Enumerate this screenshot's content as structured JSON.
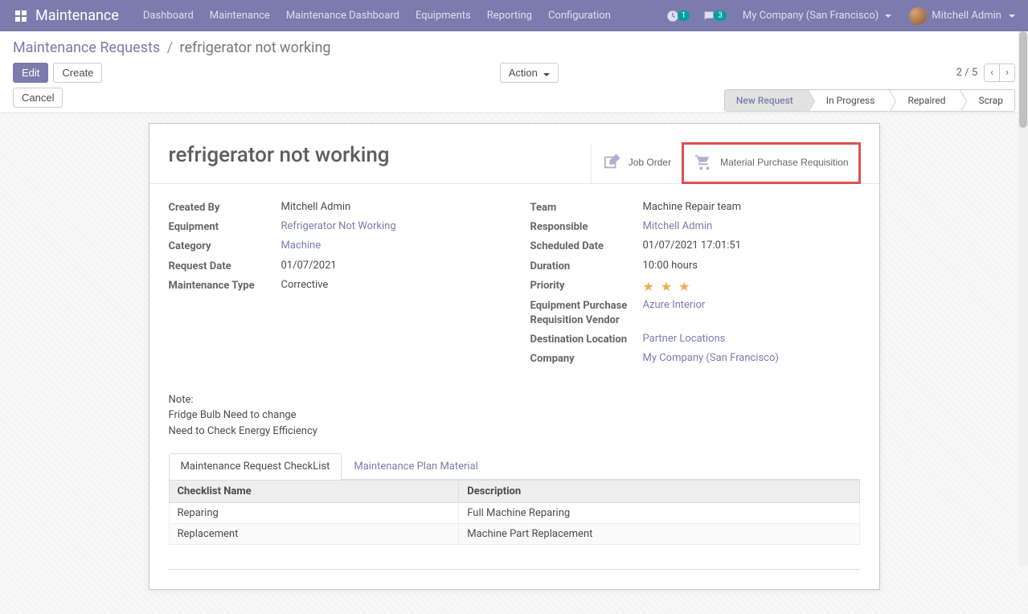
{
  "navbar": {
    "brand": "Maintenance",
    "items": [
      "Dashboard",
      "Maintenance",
      "Maintenance Dashboard",
      "Equipments",
      "Reporting",
      "Configuration"
    ],
    "activity_count": "1",
    "discuss_count": "3",
    "company": "My Company (San Francisco)",
    "user_name": "Mitchell Admin"
  },
  "breadcrumb": {
    "parent": "Maintenance Requests",
    "active": "refrigerator not working"
  },
  "buttons": {
    "edit": "Edit",
    "create": "Create",
    "action": "Action",
    "cancel": "Cancel"
  },
  "pager": {
    "text": "2 / 5"
  },
  "status_steps": [
    "New Request",
    "In Progress",
    "Repaired",
    "Scrap"
  ],
  "status_active_index": 0,
  "record": {
    "title": "refrigerator not working",
    "stat_buttons": {
      "job_order": "Job Order",
      "material_req": "Material Purchase Requisition"
    },
    "left_fields": {
      "created_by": {
        "label": "Created By",
        "value": "Mitchell Admin"
      },
      "equipment": {
        "label": "Equipment",
        "value": "Refrigerator Not Working",
        "link": true
      },
      "category": {
        "label": "Category",
        "value": "Machine",
        "link": true
      },
      "request_date": {
        "label": "Request Date",
        "value": "01/07/2021"
      },
      "maintenance_type": {
        "label": "Maintenance Type",
        "value": "Corrective"
      }
    },
    "right_fields": {
      "team": {
        "label": "Team",
        "value": "Machine Repair team"
      },
      "responsible": {
        "label": "Responsible",
        "value": "Mitchell Admin",
        "link": true
      },
      "scheduled_date": {
        "label": "Scheduled Date",
        "value": "01/07/2021 17:01:51"
      },
      "duration": {
        "label": "Duration",
        "value": "10:00  hours"
      },
      "priority": {
        "label": "Priority",
        "stars": 3
      },
      "vendor": {
        "label": "Equipment Purchase Requisition Vendor",
        "value": "Azure Interior",
        "link": true
      },
      "destination": {
        "label": "Destination Location",
        "value": "Partner Locations",
        "link": true
      },
      "company": {
        "label": "Company",
        "value": "My Company (San Francisco)",
        "link": true
      }
    },
    "note": {
      "label": "Note:",
      "line1": "Fridge Bulb Need to change",
      "line2": "Need to Check Energy Efficiency"
    },
    "tabs": [
      "Maintenance Request CheckList",
      "Maintenance Plan Material"
    ],
    "checklist": {
      "headers": [
        "Checklist Name",
        "Description"
      ],
      "rows": [
        {
          "name": "Reparing",
          "desc": "Full Machine Reparing"
        },
        {
          "name": "Replacement",
          "desc": "Machine Part Replacement"
        }
      ]
    }
  }
}
